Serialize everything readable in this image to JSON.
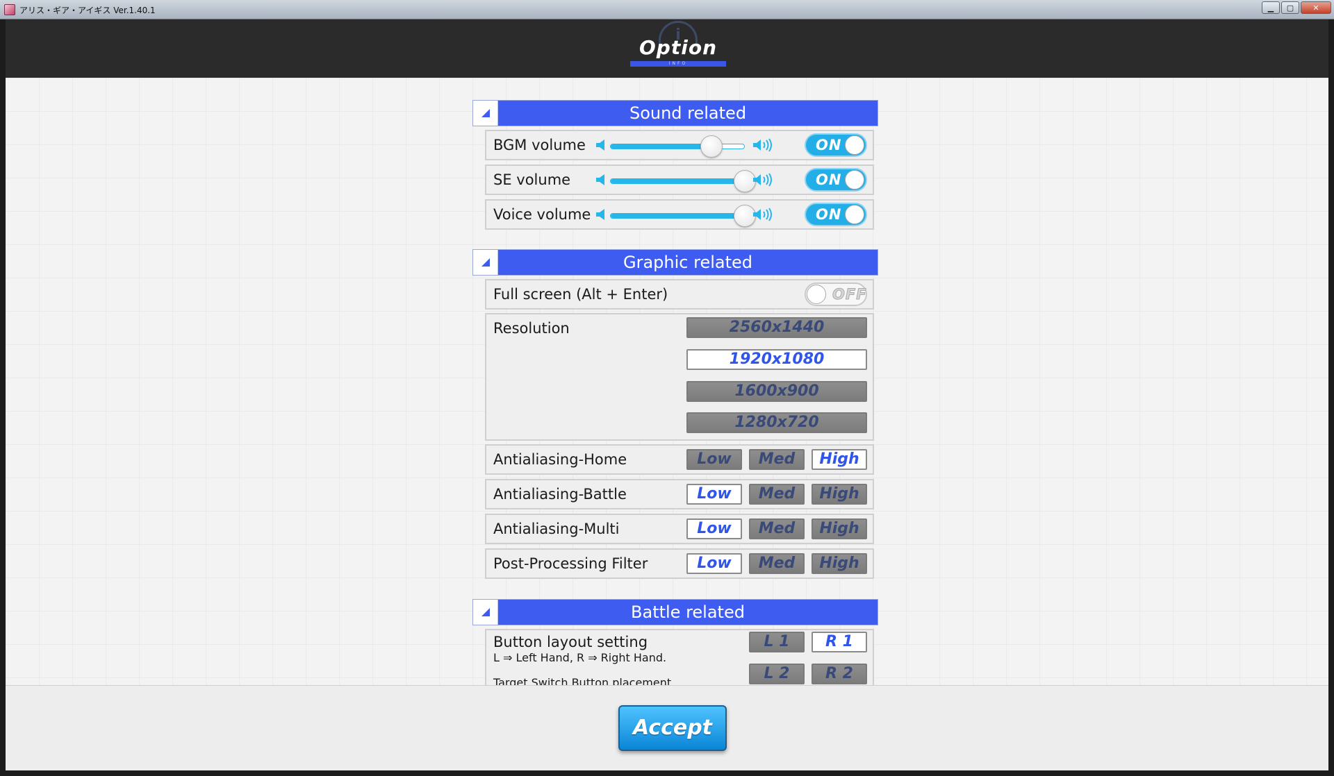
{
  "window": {
    "title": "アリス・ギア・アイギス Ver.1.40.1",
    "minimize": "▁",
    "maximize": "▢",
    "close": "✕"
  },
  "header": {
    "info_glyph": "i",
    "title": "Option",
    "subtitle": "INFO"
  },
  "sections": {
    "sound": {
      "title": "Sound related"
    },
    "graphic": {
      "title": "Graphic related"
    },
    "battle": {
      "title": "Battle related"
    }
  },
  "sound": {
    "bgm": {
      "label": "BGM volume",
      "level": 0.75,
      "state": "ON"
    },
    "se": {
      "label": "SE volume",
      "level": 1.0,
      "state": "ON"
    },
    "voice": {
      "label": "Voice volume",
      "level": 1.0,
      "state": "ON"
    }
  },
  "graphic": {
    "fullscreen": {
      "label": "Full screen (Alt + Enter)",
      "state": "OFF"
    },
    "resolution": {
      "label": "Resolution",
      "options": [
        "2560x1440",
        "1920x1080",
        "1600x900",
        "1280x720"
      ],
      "selected": "1920x1080"
    },
    "aa_home": {
      "label": "Antialiasing-Home",
      "options": [
        "Low",
        "Med",
        "High"
      ],
      "selected": "High"
    },
    "aa_battle": {
      "label": "Antialiasing-Battle",
      "options": [
        "Low",
        "Med",
        "High"
      ],
      "selected": "Low"
    },
    "aa_multi": {
      "label": "Antialiasing-Multi",
      "options": [
        "Low",
        "Med",
        "High"
      ],
      "selected": "Low"
    },
    "post_filter": {
      "label": "Post-Processing Filter",
      "options": [
        "Low",
        "Med",
        "High"
      ],
      "selected": "Low"
    }
  },
  "battle": {
    "button_layout": {
      "label": "Button layout setting",
      "hint": "L ⇒ Left Hand, R ⇒ Right Hand.",
      "next_label_cut": "Target Switch Button placement",
      "options": [
        "L 1",
        "R 1",
        "L 2",
        "R 2"
      ],
      "selected": "R 1"
    }
  },
  "accept_label": "Accept",
  "colors": {
    "accent_blue": "#3e5cf0",
    "toggle_on": "#23aee8",
    "selected_text": "#2f55ea"
  }
}
